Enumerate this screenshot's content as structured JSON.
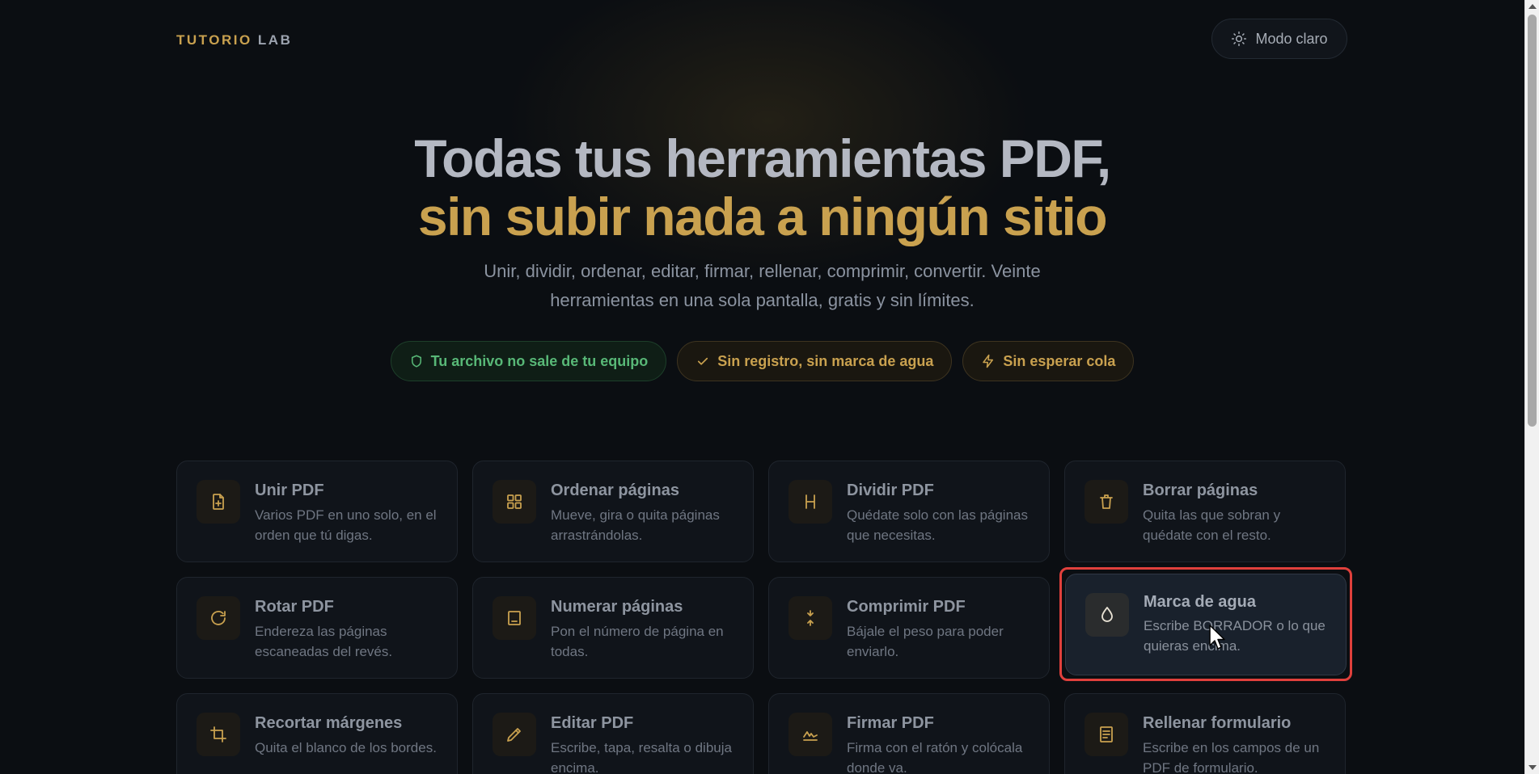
{
  "header": {
    "brand_part1": "TUTORIO",
    "brand_part2": "LAB",
    "mode_button_label": "Modo claro"
  },
  "hero": {
    "title_line1": "Todas tus herramientas PDF,",
    "title_line2": "sin subir nada a ningún sitio",
    "subtitle": "Unir, dividir, ordenar, editar, firmar, rellenar, comprimir, convertir. Veinte herramientas en una sola pantalla, gratis y sin límites.",
    "badges": [
      {
        "label": "Tu archivo no sale de tu equipo",
        "icon": "shield-icon"
      },
      {
        "label": "Sin registro, sin marca de agua",
        "icon": "check-icon"
      },
      {
        "label": "Sin esperar cola",
        "icon": "bolt-icon"
      }
    ]
  },
  "tools": [
    {
      "title": "Unir PDF",
      "description": "Varios PDF en uno solo, en el orden que tú digas.",
      "icon": "file-plus-icon"
    },
    {
      "title": "Ordenar páginas",
      "description": "Mueve, gira o quita páginas arrastrándolas.",
      "icon": "grid-icon"
    },
    {
      "title": "Dividir PDF",
      "description": "Quédate solo con las páginas que necesitas.",
      "icon": "split-icon"
    },
    {
      "title": "Borrar páginas",
      "description": "Quita las que sobran y quédate con el resto.",
      "icon": "trash-icon"
    },
    {
      "title": "Rotar PDF",
      "description": "Endereza las páginas escaneadas del revés.",
      "icon": "rotate-icon"
    },
    {
      "title": "Numerar páginas",
      "description": "Pon el número de página en todas.",
      "icon": "page-number-icon"
    },
    {
      "title": "Comprimir PDF",
      "description": "Bájale el peso para poder enviarlo.",
      "icon": "compress-icon"
    },
    {
      "title": "Marca de agua",
      "description": "Escribe BORRADOR o lo que quieras encima.",
      "icon": "droplet-icon"
    },
    {
      "title": "Recortar márgenes",
      "description": "Quita el blanco de los bordes.",
      "icon": "crop-icon"
    },
    {
      "title": "Editar PDF",
      "description": "Escribe, tapa, resalta o dibuja encima.",
      "icon": "pencil-icon"
    },
    {
      "title": "Firmar PDF",
      "description": "Firma con el ratón y colócala donde va.",
      "icon": "signature-icon"
    },
    {
      "title": "Rellenar formulario",
      "description": "Escribe en los campos de un PDF de formulario.",
      "icon": "form-icon"
    }
  ],
  "colors": {
    "accent_gold": "#c9a14f",
    "safe_green": "#58b877",
    "background": "#0b0e12",
    "highlight_red": "#e0403c"
  }
}
